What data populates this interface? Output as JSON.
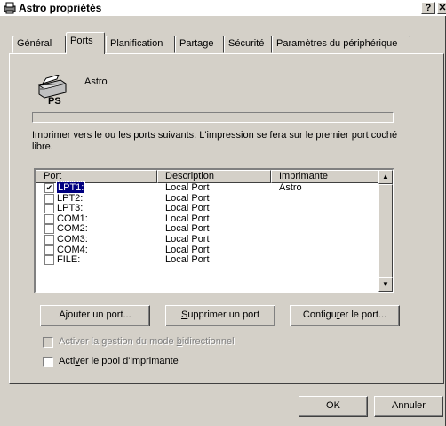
{
  "window": {
    "title": "Astro propriétés",
    "help_glyph": "?",
    "close_glyph": "✕"
  },
  "tabs": [
    {
      "label": "Général"
    },
    {
      "label": "Ports"
    },
    {
      "label": "Planification"
    },
    {
      "label": "Partage"
    },
    {
      "label": "Sécurité"
    },
    {
      "label": "Paramètres du périphérique"
    }
  ],
  "active_tab": "Ports",
  "printer": {
    "name": "Astro",
    "icon": "printer-ps-icon"
  },
  "instructions": "Imprimer vers le ou les ports suivants. L'impression se fera sur le premier port coché libre.",
  "port_list": {
    "headers": {
      "port": "Port",
      "description": "Description",
      "printer": "Imprimante"
    },
    "rows": [
      {
        "port": "LPT1:",
        "description": "Local Port",
        "printer": "Astro",
        "checked": true,
        "selected": true
      },
      {
        "port": "LPT2:",
        "description": "Local Port",
        "printer": "",
        "checked": false,
        "selected": false
      },
      {
        "port": "LPT3:",
        "description": "Local Port",
        "printer": "",
        "checked": false,
        "selected": false
      },
      {
        "port": "COM1:",
        "description": "Local Port",
        "printer": "",
        "checked": false,
        "selected": false
      },
      {
        "port": "COM2:",
        "description": "Local Port",
        "printer": "",
        "checked": false,
        "selected": false
      },
      {
        "port": "COM3:",
        "description": "Local Port",
        "printer": "",
        "checked": false,
        "selected": false
      },
      {
        "port": "COM4:",
        "description": "Local Port",
        "printer": "",
        "checked": false,
        "selected": false
      },
      {
        "port": "FILE:",
        "description": "Local Port",
        "printer": "",
        "checked": false,
        "selected": false
      }
    ]
  },
  "buttons": {
    "add_port": {
      "pre": "A",
      "ul": "j",
      "post": "outer un port..."
    },
    "delete_port": {
      "pre": "",
      "ul": "S",
      "post": "upprimer un port"
    },
    "configure_port": {
      "pre": "Configu",
      "ul": "r",
      "post": "er le port..."
    },
    "ok": "OK",
    "cancel": "Annuler"
  },
  "options": {
    "bidirectional": {
      "pre": "Activer la gestion du mode ",
      "ul": "b",
      "post": "idirectionnel",
      "checked": false,
      "enabled": false
    },
    "pooling": {
      "pre": "Acti",
      "ul": "v",
      "post": "er le pool d'imprimante",
      "checked": false,
      "enabled": true
    }
  },
  "colors": {
    "face": "#d4d0c8",
    "selection": "#000080"
  }
}
